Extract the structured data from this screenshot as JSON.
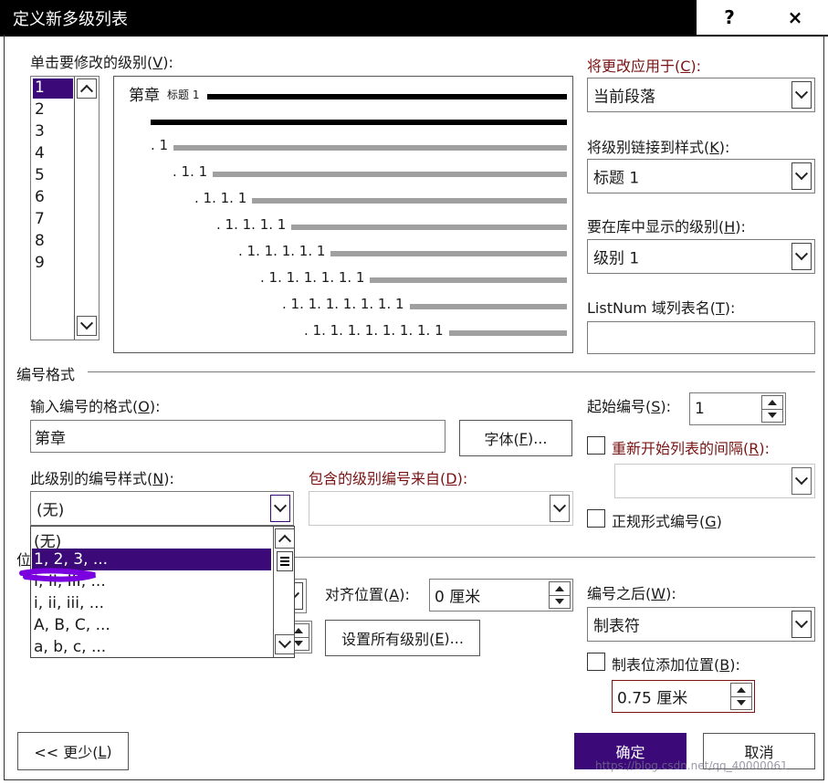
{
  "window": {
    "title": "定义新多级列表",
    "help_glyph": "?",
    "close_glyph": "×"
  },
  "level_select": {
    "label_pre": "单击要修改的级别(",
    "label_key": "V",
    "label_post": "):",
    "levels": [
      "1",
      "2",
      "3",
      "4",
      "5",
      "6",
      "7",
      "8",
      "9"
    ],
    "selected": "1"
  },
  "preview": {
    "first_text": "第章",
    "first_style": "标题 1",
    "numbers": [
      ". 1",
      ". 1. 1",
      ". 1. 1. 1",
      ". 1. 1. 1. 1",
      ". 1. 1. 1. 1. 1",
      ". 1. 1. 1. 1. 1. 1",
      ". 1. 1. 1. 1. 1. 1. 1",
      ". 1. 1. 1. 1. 1. 1. 1. 1"
    ]
  },
  "apply_to": {
    "label_pre": "将更改应用于(",
    "label_key": "C",
    "label_post": "):",
    "value": "当前段落"
  },
  "link_style": {
    "label_pre": "将级别链接到样式(",
    "label_key": "K",
    "label_post": "):",
    "value": "标题 1"
  },
  "gallery_level": {
    "label_pre": "要在库中显示的级别(",
    "label_key": "H",
    "label_post": "):",
    "value": "级别 1"
  },
  "listnum": {
    "label_pre": "ListNum 域列表名(",
    "label_key": "T",
    "label_post": "):",
    "value": ""
  },
  "number_format": {
    "section_title": "编号格式",
    "input_label_pre": "输入编号的格式(",
    "input_label_key": "O",
    "input_label_post": "):",
    "input_value": "第章",
    "font_button_pre": "字体(",
    "font_button_key": "F",
    "font_button_post": ")...",
    "style_label_pre": "此级别的编号样式(",
    "style_label_key": "N",
    "style_label_post": "):",
    "style_value": "(无)",
    "include_label_pre": "包含的级别编号来自(",
    "include_label_key": "D",
    "include_label_post": "):",
    "include_value": "",
    "start_label_pre": "起始编号(",
    "start_label_key": "S",
    "start_label_post": "):",
    "start_value": "1",
    "restart_label_pre": "重新开始列表的间隔(",
    "restart_label_key": "R",
    "restart_label_post": "):",
    "restart_checked": false,
    "restart_value": "",
    "legal_label_pre": "正规形式编号(",
    "legal_label_key": "G",
    "legal_label_post": ")",
    "legal_checked": false
  },
  "style_dropdown": {
    "options": [
      "(无)",
      "1, 2, 3, ...",
      "I, II, III, ...",
      "i, ii, iii, ...",
      "A, B, C, ...",
      "a, b, c, ..."
    ],
    "highlighted": "1, 2, 3, ..."
  },
  "position": {
    "section_title_partial": "位",
    "align_label_pre": "对齐位置(",
    "align_label_key": "A",
    "align_label_post": "):",
    "align_value": "0 厘米",
    "set_all_pre": "设置所有级别(",
    "set_all_key": "E",
    "set_all_post": ")...",
    "after_label_pre": "编号之后(",
    "after_label_key": "W",
    "after_label_post": "):",
    "after_value": "制表符",
    "tab_add_label_pre": "制表位添加位置(",
    "tab_add_label_key": "B",
    "tab_add_label_post": "):",
    "tab_add_checked": false,
    "tab_value": "0.75 厘米"
  },
  "footer": {
    "less_pre": "<< 更少(",
    "less_key": "L",
    "less_post": ")",
    "ok": "确定",
    "cancel": "取消",
    "watermark": "https://blog.csdn.net/qq_40000061"
  },
  "colors": {
    "accent": "#3b0a78",
    "title_bar": "#000000",
    "label_red": "#7a1414",
    "annotation": "#7b00e0"
  }
}
